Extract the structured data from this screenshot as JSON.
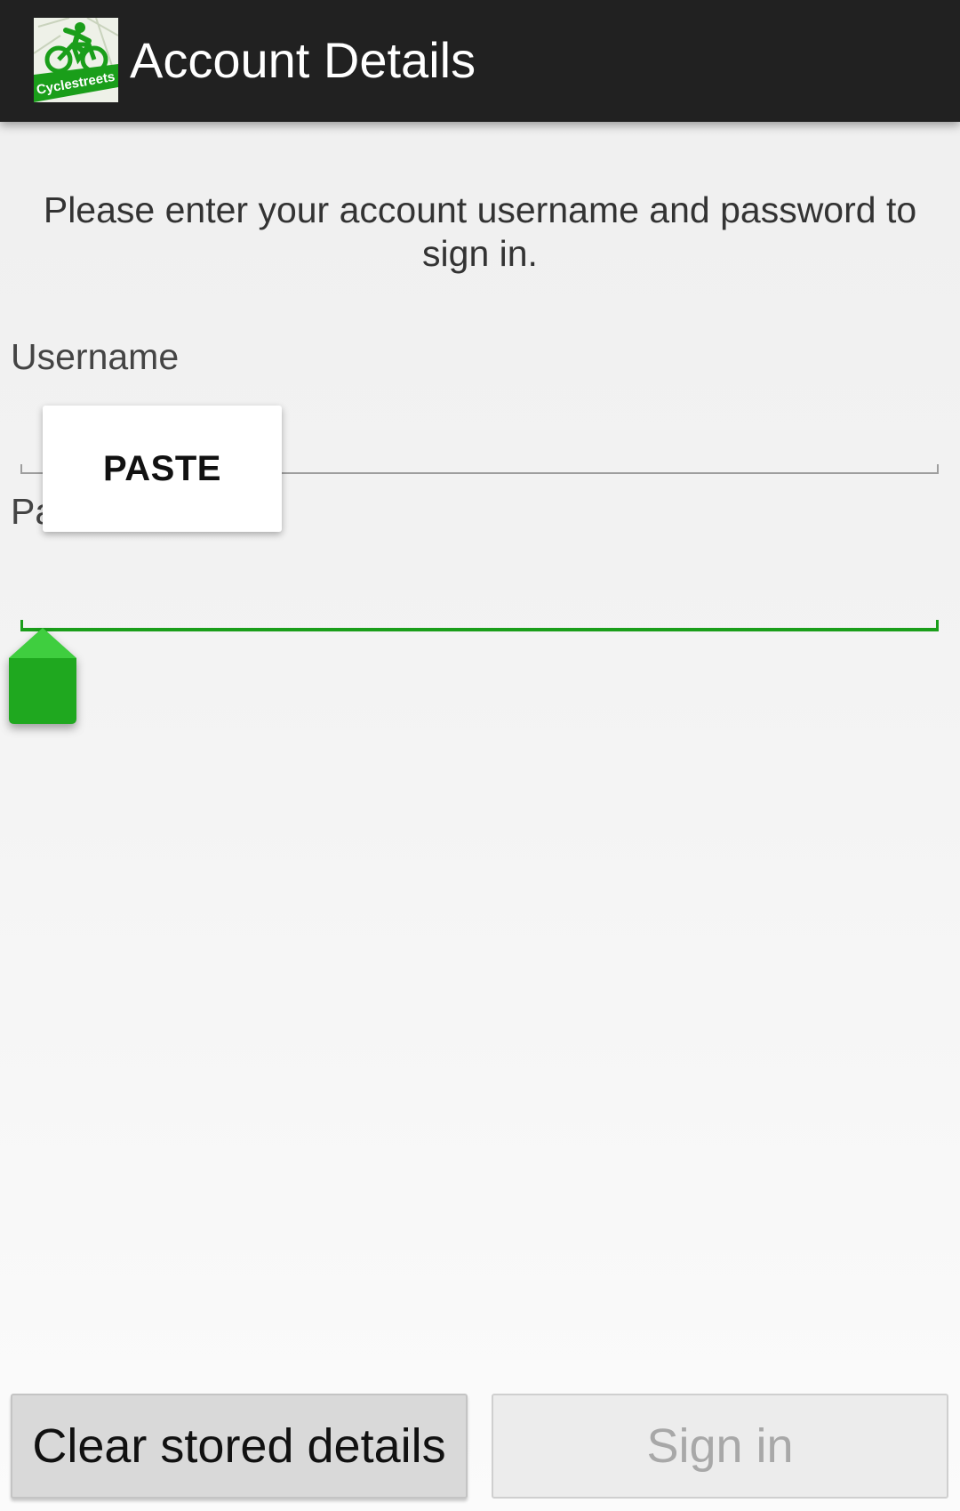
{
  "action_bar": {
    "title": "Account Details",
    "logo_text": "Cyclestreets",
    "logo_icon": "cyclist-logo-icon"
  },
  "form": {
    "instructions": "Please enter your account username and password to sign in.",
    "username": {
      "label": "Username",
      "value": ""
    },
    "password": {
      "label": "Password",
      "value": ""
    }
  },
  "context_menu": {
    "paste_label": "PASTE"
  },
  "buttons": {
    "clear_label": "Clear stored details",
    "signin_label": "Sign in",
    "signin_enabled": false
  },
  "colors": {
    "action_bar": "#212121",
    "accent_green": "#1a9e1a",
    "handle_green": "#22b022"
  },
  "icons": [
    "cyclist-logo-icon",
    "text-cursor-handle-icon"
  ]
}
